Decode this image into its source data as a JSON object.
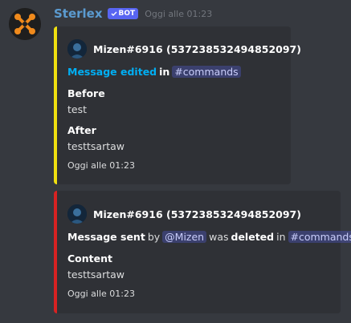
{
  "message": {
    "author": "Sterlex",
    "bot_tag": "BOT",
    "timestamp": "Oggi alle 01:23",
    "avatar_icon": "crossed-tools-icon"
  },
  "embeds": [
    {
      "color": "#f0e010",
      "author_name": "Mizen#6916 (537238532494852097)",
      "desc_link": "Message edited",
      "desc_in": "in",
      "desc_channel": "#commands",
      "fields": [
        {
          "name": "Before",
          "value": "test"
        },
        {
          "name": "After",
          "value": "testtsartaw"
        }
      ],
      "footer": "Oggi alle 01:23"
    },
    {
      "color": "#d82222",
      "author_name": "Mizen#6916 (537238532494852097)",
      "desc_sent": "Message sent",
      "desc_by": "by",
      "desc_mention": "@Mizen",
      "desc_was": "was",
      "desc_deleted": "deleted",
      "desc_in": "in",
      "desc_channel": "#commands",
      "fields": [
        {
          "name": "Content",
          "value": "testtsartaw"
        }
      ],
      "footer": "Oggi alle 01:23"
    }
  ]
}
